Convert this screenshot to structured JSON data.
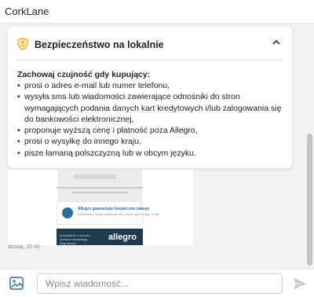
{
  "header": {
    "title": "CorkLane"
  },
  "card": {
    "title": "Bezpieczeństwo na lokalnie",
    "warning_heading": "Zachowaj czujność gdy kupujący:",
    "tips": [
      "prosi o adres e-mail lub numer telefonu,",
      "wysyła sms lub wiadomości zawierające odnośniki do stron wymagających podania danych kart kredytowych i/lub zalogowania się do bankowości elektronicznej,",
      "proponuje wyższą cenę i płatność poza Allegro,",
      "prosi o wysyłkę do innego kraju,",
      "pisze łamaną polszczyzną lub w obcym języku."
    ]
  },
  "attachment": {
    "box_heading": "Allegro gwarantuje bezpieczne zakupy",
    "box_text": "Skorzystaj z kupuj przedmiot albo zwróć się w ciągu 14 dni.",
    "footer_text": "Korzystanie z serwisu oznacza akceptację Regulaminu.",
    "logo": "allegro"
  },
  "message": {
    "time": "dzisiaj, 20:40"
  },
  "composer": {
    "placeholder": "Wpisz wiadomość..."
  },
  "icons": {
    "shield": "shield-icon",
    "chevron": "chevron-up-icon",
    "image": "image-icon",
    "send": "send-icon"
  },
  "colors": {
    "accent": "#f5a623",
    "brand": "#2a6f97"
  }
}
